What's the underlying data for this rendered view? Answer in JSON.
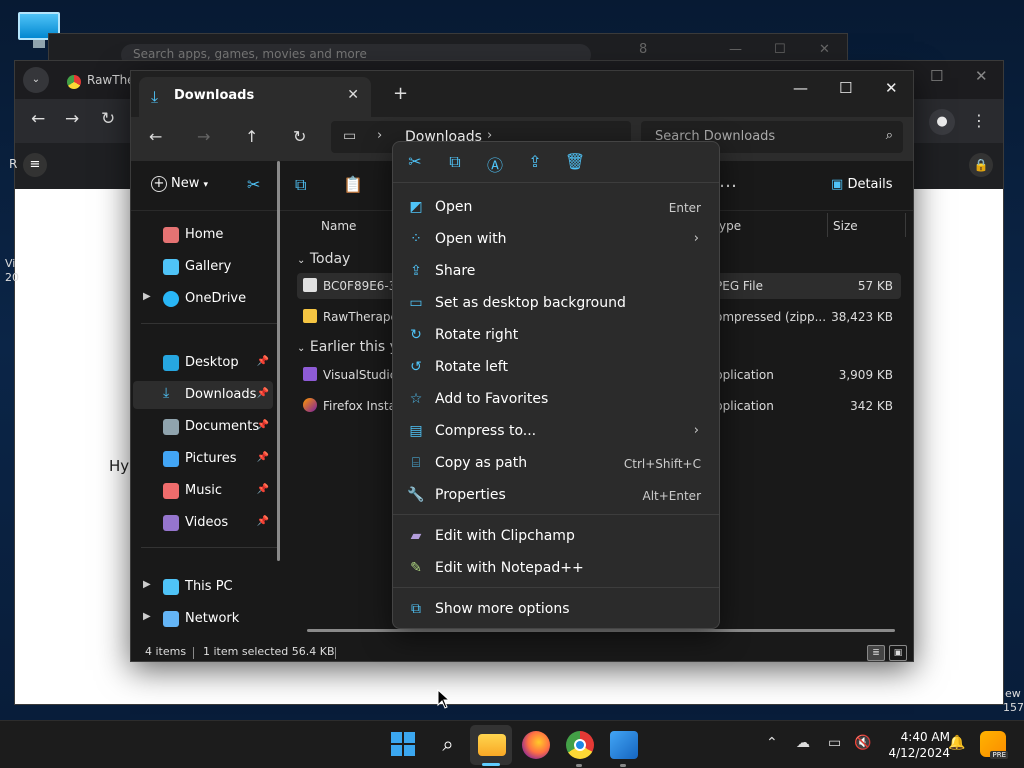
{
  "background_window": {
    "search_placeholder": "Search apps, games, movies and more",
    "badge": "8"
  },
  "browser": {
    "tab_title": "RawThe",
    "page_fragments": {
      "left_r": "R",
      "left_vi": "Vi",
      "left_20": "20",
      "hy": "Hy",
      "right_ew": "ew",
      "right_157": "157"
    }
  },
  "explorer": {
    "tab_title": "Downloads",
    "breadcrumb": "Downloads",
    "search_placeholder": "Search Downloads",
    "new_label": "New",
    "details_label": "Details",
    "nav": {
      "home": "Home",
      "gallery": "Gallery",
      "onedrive": "OneDrive",
      "desktop": "Desktop",
      "downloads": "Downloads",
      "documents": "Documents",
      "pictures": "Pictures",
      "music": "Music",
      "videos": "Videos",
      "thispc": "This PC",
      "network": "Network"
    },
    "columns": {
      "name": "Name",
      "type": "ype",
      "size": "Size"
    },
    "groups": {
      "today": "Today",
      "earlier": "Earlier this y"
    },
    "files": [
      {
        "name": "BC0F89E6-3",
        "type": "PEG File",
        "size": "57 KB"
      },
      {
        "name": "RawTherape",
        "type": "ompressed (zipp...",
        "size": "38,423 KB"
      },
      {
        "name": "VisualStudic",
        "type": "pplication",
        "size": "3,909 KB"
      },
      {
        "name": "Firefox Insta",
        "type": "pplication",
        "size": "342 KB"
      }
    ],
    "status": {
      "count": "4 items",
      "selected": "1 item selected  56.4 KB"
    }
  },
  "context_menu": {
    "items": [
      {
        "label": "Open",
        "shortcut": "Enter"
      },
      {
        "label": "Open with",
        "shortcut": ""
      },
      {
        "label": "Share",
        "shortcut": ""
      },
      {
        "label": "Set as desktop background",
        "shortcut": ""
      },
      {
        "label": "Rotate right",
        "shortcut": ""
      },
      {
        "label": "Rotate left",
        "shortcut": ""
      },
      {
        "label": "Add to Favorites",
        "shortcut": ""
      },
      {
        "label": "Compress to...",
        "shortcut": ""
      },
      {
        "label": "Copy as path",
        "shortcut": "Ctrl+Shift+C"
      },
      {
        "label": "Properties",
        "shortcut": "Alt+Enter"
      },
      {
        "label": "Edit with Clipchamp",
        "shortcut": ""
      },
      {
        "label": "Edit with Notepad++",
        "shortcut": ""
      },
      {
        "label": "Show more options",
        "shortcut": ""
      }
    ]
  },
  "taskbar": {
    "time": "4:40 AM",
    "date": "4/12/2024",
    "copilot_badge": "PRE"
  },
  "colors": {
    "accent": "#60cdff",
    "menu_bg": "#2b2b2b",
    "explorer_bg": "#191919"
  }
}
